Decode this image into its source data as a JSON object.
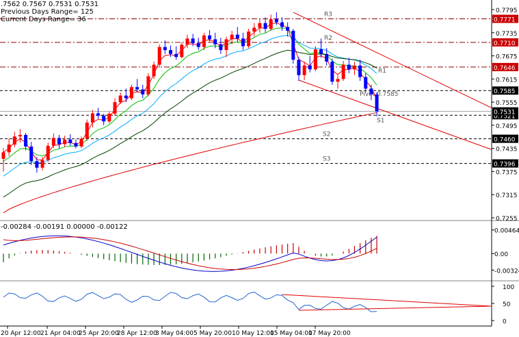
{
  "header": {
    "ohlc": ".7562 0.7567 0.7531 0.7531",
    "previous_range": "Previous Days Range= 125",
    "current_range": "Current Days Range= 36"
  },
  "macd_header": "-0.00284 -0.00191 0.00000 -0.00122",
  "pivot_label": "Pivot 0.7585",
  "colors": {
    "background": "#ffffff",
    "grid": "#000000",
    "bull": "#ff0000",
    "bear": "#0000ff",
    "ema_fast": "#ff0000",
    "ema_mid": "#00c000",
    "ema_slow": "#00aaff",
    "ema_long": "#004000",
    "ema_200": "#dd0000",
    "level_box": "#cc0000",
    "pivot_box": "#000000"
  },
  "chart_data": [
    {
      "type": "candlestick",
      "title": "",
      "ylim": [
        0.7255,
        0.7805
      ],
      "price_ticks": [
        "0.7795",
        "0.7735",
        "0.7675",
        "0.7615",
        "0.7555",
        "0.7495",
        "0.7435",
        "0.7375",
        "0.7315",
        "0.7255"
      ],
      "time_ticks": [
        "20 Apr 12:00",
        "21 Apr 04:00",
        "25 Apr 20:00",
        "28 Apr 12:00",
        "3 May 04:00",
        "5 May 20:00",
        "10 May 12:00",
        "15 May 04:00",
        "17 May 20:00"
      ],
      "levels": [
        {
          "name": "R3",
          "value": 0.7771,
          "label_box": "0.7771",
          "style": "level"
        },
        {
          "name": "R2",
          "value": 0.771,
          "label_box": "0.7710",
          "style": "level"
        },
        {
          "name": "R1",
          "value": 0.7646,
          "label_box": "0.7646",
          "style": "level"
        },
        {
          "name": "Pivot",
          "value": 0.7585,
          "label_box": "0.7585",
          "style": "pivot"
        },
        {
          "name": "S1",
          "value": 0.7521,
          "label_box": "0.7521",
          "style": "pivot"
        },
        {
          "name": "S2",
          "value": 0.746,
          "label_box": "0.7460",
          "style": "pivot"
        },
        {
          "name": "S3",
          "value": 0.7396,
          "label_box": "0.7396",
          "style": "pivot"
        }
      ],
      "current_price_box": "0.7531",
      "candles": [
        [
          0.7408,
          0.7436,
          0.7375,
          0.7425
        ],
        [
          0.7425,
          0.746,
          0.7415,
          0.7445
        ],
        [
          0.7445,
          0.7478,
          0.7438,
          0.7466
        ],
        [
          0.7466,
          0.7485,
          0.745,
          0.747
        ],
        [
          0.747,
          0.7475,
          0.743,
          0.744
        ],
        [
          0.744,
          0.7452,
          0.7392,
          0.7402
        ],
        [
          0.7402,
          0.7412,
          0.7372,
          0.7385
        ],
        [
          0.7385,
          0.7412,
          0.7378,
          0.7405
        ],
        [
          0.7405,
          0.745,
          0.74,
          0.7442
        ],
        [
          0.7442,
          0.7474,
          0.7436,
          0.7462
        ],
        [
          0.7462,
          0.747,
          0.7435,
          0.7446
        ],
        [
          0.7446,
          0.7468,
          0.7438,
          0.7458
        ],
        [
          0.7458,
          0.7472,
          0.7442,
          0.7449
        ],
        [
          0.7449,
          0.7458,
          0.7435,
          0.744
        ],
        [
          0.744,
          0.7466,
          0.7436,
          0.746
        ],
        [
          0.746,
          0.751,
          0.7455,
          0.7502
        ],
        [
          0.7502,
          0.7535,
          0.749,
          0.7526
        ],
        [
          0.7526,
          0.754,
          0.7512,
          0.752
        ],
        [
          0.752,
          0.7525,
          0.7495,
          0.7505
        ],
        [
          0.7505,
          0.753,
          0.75,
          0.7525
        ],
        [
          0.7525,
          0.7565,
          0.752,
          0.7555
        ],
        [
          0.7555,
          0.758,
          0.755,
          0.7572
        ],
        [
          0.7572,
          0.759,
          0.7555,
          0.7565
        ],
        [
          0.7565,
          0.76,
          0.756,
          0.7594
        ],
        [
          0.7594,
          0.7615,
          0.758,
          0.7588
        ],
        [
          0.7588,
          0.76,
          0.7565,
          0.7575
        ],
        [
          0.7575,
          0.763,
          0.757,
          0.7622
        ],
        [
          0.7622,
          0.766,
          0.7615,
          0.7652
        ],
        [
          0.7652,
          0.7705,
          0.7645,
          0.7698
        ],
        [
          0.7698,
          0.7715,
          0.768,
          0.769
        ],
        [
          0.769,
          0.7702,
          0.7672,
          0.768
        ],
        [
          0.768,
          0.77,
          0.7665,
          0.7672
        ],
        [
          0.7672,
          0.771,
          0.7668,
          0.7704
        ],
        [
          0.7704,
          0.773,
          0.7695,
          0.772
        ],
        [
          0.772,
          0.7732,
          0.77,
          0.7708
        ],
        [
          0.7708,
          0.7722,
          0.769,
          0.7698
        ],
        [
          0.7698,
          0.7735,
          0.769,
          0.7728
        ],
        [
          0.7728,
          0.7742,
          0.7712,
          0.7718
        ],
        [
          0.7718,
          0.7735,
          0.7695,
          0.7705
        ],
        [
          0.7705,
          0.7722,
          0.768,
          0.769
        ],
        [
          0.769,
          0.7725,
          0.7672,
          0.7718
        ],
        [
          0.7718,
          0.774,
          0.7705,
          0.773
        ],
        [
          0.773,
          0.775,
          0.7712,
          0.772
        ],
        [
          0.772,
          0.7735,
          0.769,
          0.77
        ],
        [
          0.77,
          0.7745,
          0.7695,
          0.7738
        ],
        [
          0.7738,
          0.776,
          0.7725,
          0.7748
        ],
        [
          0.7748,
          0.777,
          0.7735,
          0.776
        ],
        [
          0.776,
          0.7775,
          0.7735,
          0.7745
        ],
        [
          0.7745,
          0.7782,
          0.774,
          0.777
        ],
        [
          0.777,
          0.7788,
          0.7755,
          0.7762
        ],
        [
          0.7762,
          0.7775,
          0.774,
          0.775
        ],
        [
          0.775,
          0.7762,
          0.7725,
          0.774
        ],
        [
          0.774,
          0.7745,
          0.7655,
          0.7665
        ],
        [
          0.7665,
          0.7672,
          0.761,
          0.7625
        ],
        [
          0.7625,
          0.766,
          0.7612,
          0.765
        ],
        [
          0.765,
          0.7675,
          0.7632,
          0.764
        ],
        [
          0.764,
          0.77,
          0.7635,
          0.7692
        ],
        [
          0.7692,
          0.772,
          0.767,
          0.768
        ],
        [
          0.768,
          0.7695,
          0.765,
          0.766
        ],
        [
          0.766,
          0.7668,
          0.76,
          0.7608
        ],
        [
          0.7608,
          0.7625,
          0.759,
          0.7615
        ],
        [
          0.7615,
          0.7662,
          0.761,
          0.7652
        ],
        [
          0.7652,
          0.767,
          0.763,
          0.764
        ],
        [
          0.764,
          0.766,
          0.7625,
          0.765
        ],
        [
          0.765,
          0.7665,
          0.761,
          0.762
        ],
        [
          0.762,
          0.763,
          0.758,
          0.759
        ],
        [
          0.759,
          0.76,
          0.756,
          0.7575
        ],
        [
          0.7575,
          0.758,
          0.7518,
          0.7531
        ]
      ]
    },
    {
      "type": "histogram",
      "title": "",
      "ylim": [
        -0.004,
        0.005
      ],
      "ticks": [
        "0.00464",
        "0.00",
        "-0.00324"
      ]
    },
    {
      "type": "line",
      "title": "",
      "ylim": [
        0,
        100
      ],
      "ticks": [
        "100",
        "50",
        "0"
      ]
    }
  ]
}
